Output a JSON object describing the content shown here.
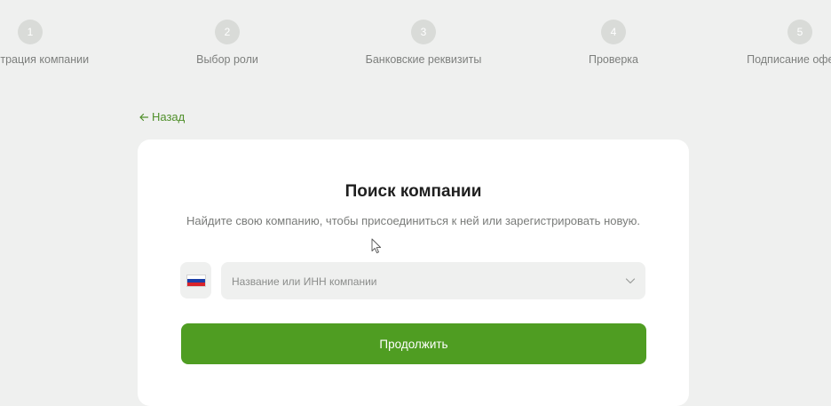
{
  "stepper": {
    "steps": [
      {
        "number": "1",
        "label": "Регистрация компании"
      },
      {
        "number": "2",
        "label": "Выбор роли"
      },
      {
        "number": "3",
        "label": "Банковские реквизиты"
      },
      {
        "number": "4",
        "label": "Проверка"
      },
      {
        "number": "5",
        "label": "Подписание оферты"
      }
    ]
  },
  "nav": {
    "back_label": "Назад",
    "back_icon": "arrow-left-icon"
  },
  "card": {
    "title": "Поиск компании",
    "subtitle": "Найдите свою компанию, чтобы присоединиться к ней или зарегистрировать новую.",
    "country_flag": "russia-flag-icon",
    "search": {
      "placeholder": "Название или ИНН компании",
      "value": ""
    },
    "continue_label": "Продолжить"
  },
  "colors": {
    "accent": "#4f9d22",
    "link": "#4f8f2a",
    "background": "#eff0ef",
    "step_inactive": "#d9dbd8"
  }
}
